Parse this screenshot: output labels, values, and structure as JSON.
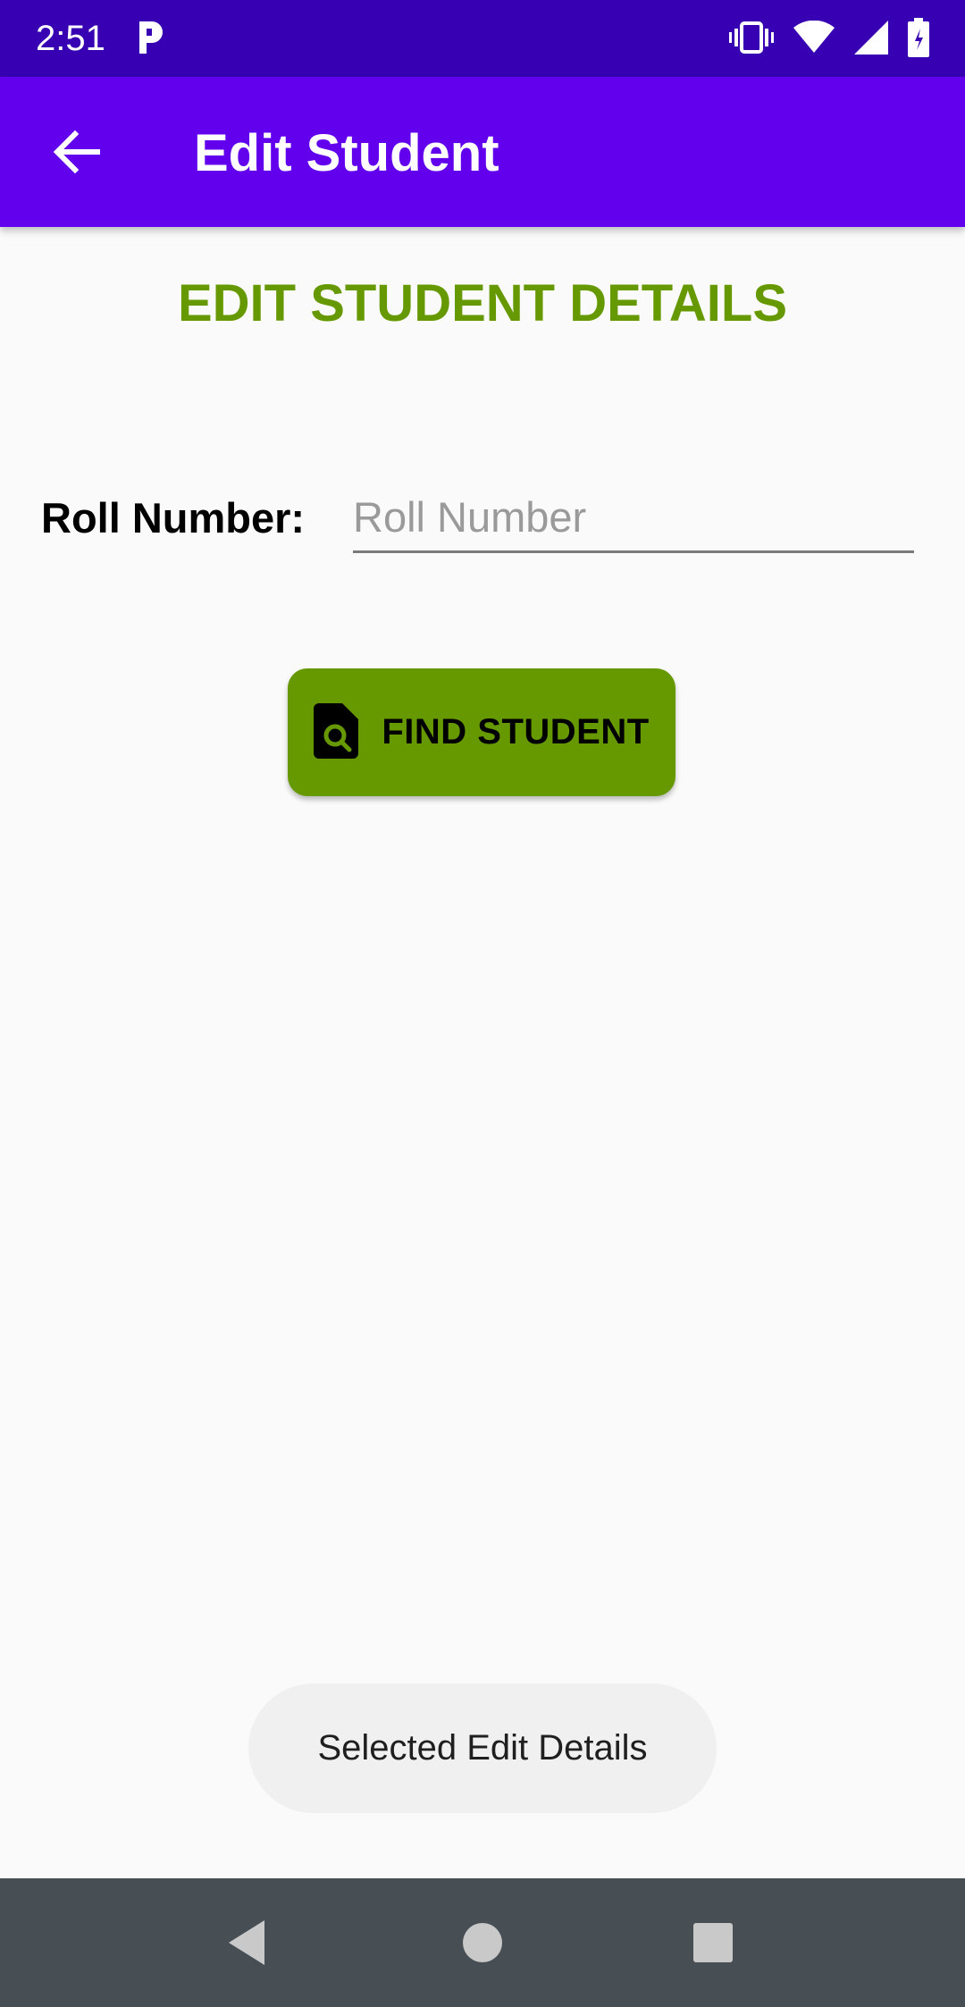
{
  "status_bar": {
    "time": "2:51",
    "icons": [
      "parking-icon",
      "vibrate-icon",
      "wifi-icon",
      "cellular-signal-icon",
      "battery-icon"
    ]
  },
  "app_bar": {
    "title": "Edit Student",
    "back_icon": "back-arrow-icon",
    "background": "#6200ee"
  },
  "main": {
    "heading": "EDIT STUDENT DETAILS",
    "heading_color": "#669900",
    "roll_label": "Roll Number:",
    "roll_input": {
      "value": "",
      "placeholder": "Roll Number"
    },
    "find_button": {
      "label": "FIND STUDENT",
      "icon": "find-in-page-icon",
      "color": "#669900"
    }
  },
  "toast": {
    "text": "Selected Edit Details"
  },
  "nav_bar": {
    "icons": [
      "back-triangle-icon",
      "home-circle-icon",
      "recents-square-icon"
    ]
  }
}
